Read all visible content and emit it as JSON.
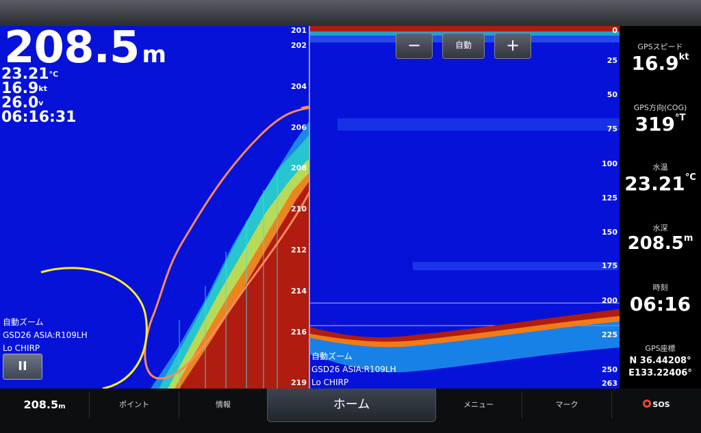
{
  "left_panel": {
    "depth_value": "208.5",
    "depth_unit": "m",
    "water_temp": "23.21",
    "water_temp_unit": "°C",
    "speed": "16.9",
    "speed_unit": "kt",
    "voltage": "26.0",
    "voltage_unit": "v",
    "time": "06:16:31",
    "depth_scale": [
      "201",
      "202",
      "204",
      "206",
      "208",
      "210",
      "212",
      "214",
      "216",
      "219"
    ],
    "auto_zoom_label": "自動ズーム",
    "transducer_label": "GSD26 ASIA:R109LH",
    "frequency_label": "Lo CHIRP",
    "pause_label": "II"
  },
  "right_panel": {
    "zoom_minus_label": "−",
    "zoom_auto_label": "自動",
    "zoom_plus_label": "+",
    "depth_scale": [
      "0",
      "25",
      "50",
      "75",
      "100",
      "125",
      "150",
      "175",
      "200",
      "225",
      "250",
      "263"
    ],
    "auto_zoom_label": "自動ズーム",
    "transducer_label": "GSD26 ASIA:R109LH",
    "frequency_label": "Lo CHIRP"
  },
  "data_bar": {
    "fields": [
      {
        "label": "GPSスピード",
        "value": "16.9",
        "unit": "kt"
      },
      {
        "label": "GPS方向(COG)",
        "value": "319",
        "unit": "°T"
      },
      {
        "label": "水温",
        "value": "23.21",
        "unit": "°C"
      },
      {
        "label": "水深",
        "value": "208.5",
        "unit": "m"
      },
      {
        "label": "時刻",
        "value": "06:16",
        "unit": ""
      }
    ],
    "position_label": "GPS座標",
    "latitude": "N  36.44208°",
    "longitude": "E133.22406°"
  },
  "bottom_nav": {
    "depth_value": "208.5",
    "depth_unit": "m",
    "point_label": "ポイント",
    "info_label": "情報",
    "home_label": "ホーム",
    "menu_label": "メニュー",
    "mark_label": "マーク",
    "sos_label": "SOS"
  },
  "colors": {
    "sonar_background": "#0612d8",
    "strong_return": "#b01c10",
    "annotation_orange": "#ff8a5a",
    "annotation_yellow": "#ffee2a"
  }
}
